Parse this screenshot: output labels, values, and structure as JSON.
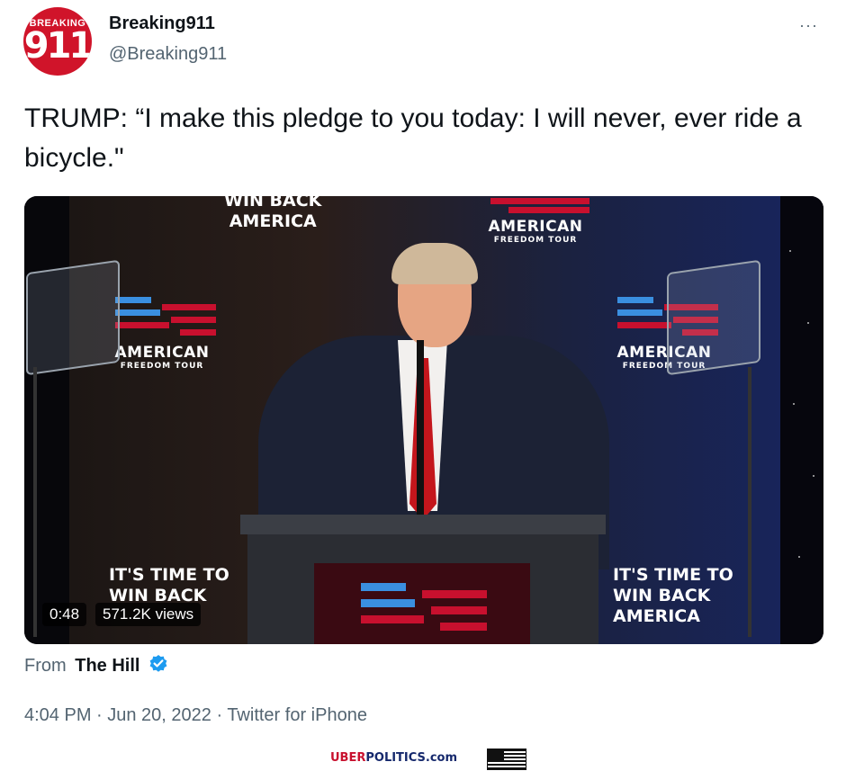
{
  "tweet": {
    "account_name": "Breaking911",
    "handle": "@Breaking911",
    "avatar_top_text": "BREAKING",
    "avatar_number": "911",
    "more_glyph": "···",
    "text": "TRUMP: “I make this pledge to you today: I will never, ever ride a bicycle.\"",
    "video": {
      "duration": "0:48",
      "views": "571.2K views",
      "backdrop": {
        "top_slogan_line1": "WIN BACK",
        "top_slogan_line2": "AMERICA",
        "logo_big": "AMERICAN",
        "logo_small": "FREEDOM TOUR",
        "bottom_slogan_line1": "IT'S TIME TO",
        "bottom_slogan_line2": "WIN BACK",
        "bottom_slogan_line3": "AMERICA"
      }
    },
    "source_prefix": "From",
    "source_name": "The Hill",
    "timestamp": "4:04 PM · Jun 20, 2022 · Twitter for iPhone"
  },
  "watermark": {
    "part1": "UBER",
    "part2": "POLITICS.com"
  },
  "colors": {
    "accent_red": "#c8102e",
    "brand_blue": "#15286c",
    "verified_blue": "#1d9bf0",
    "secondary_text": "#536471"
  }
}
